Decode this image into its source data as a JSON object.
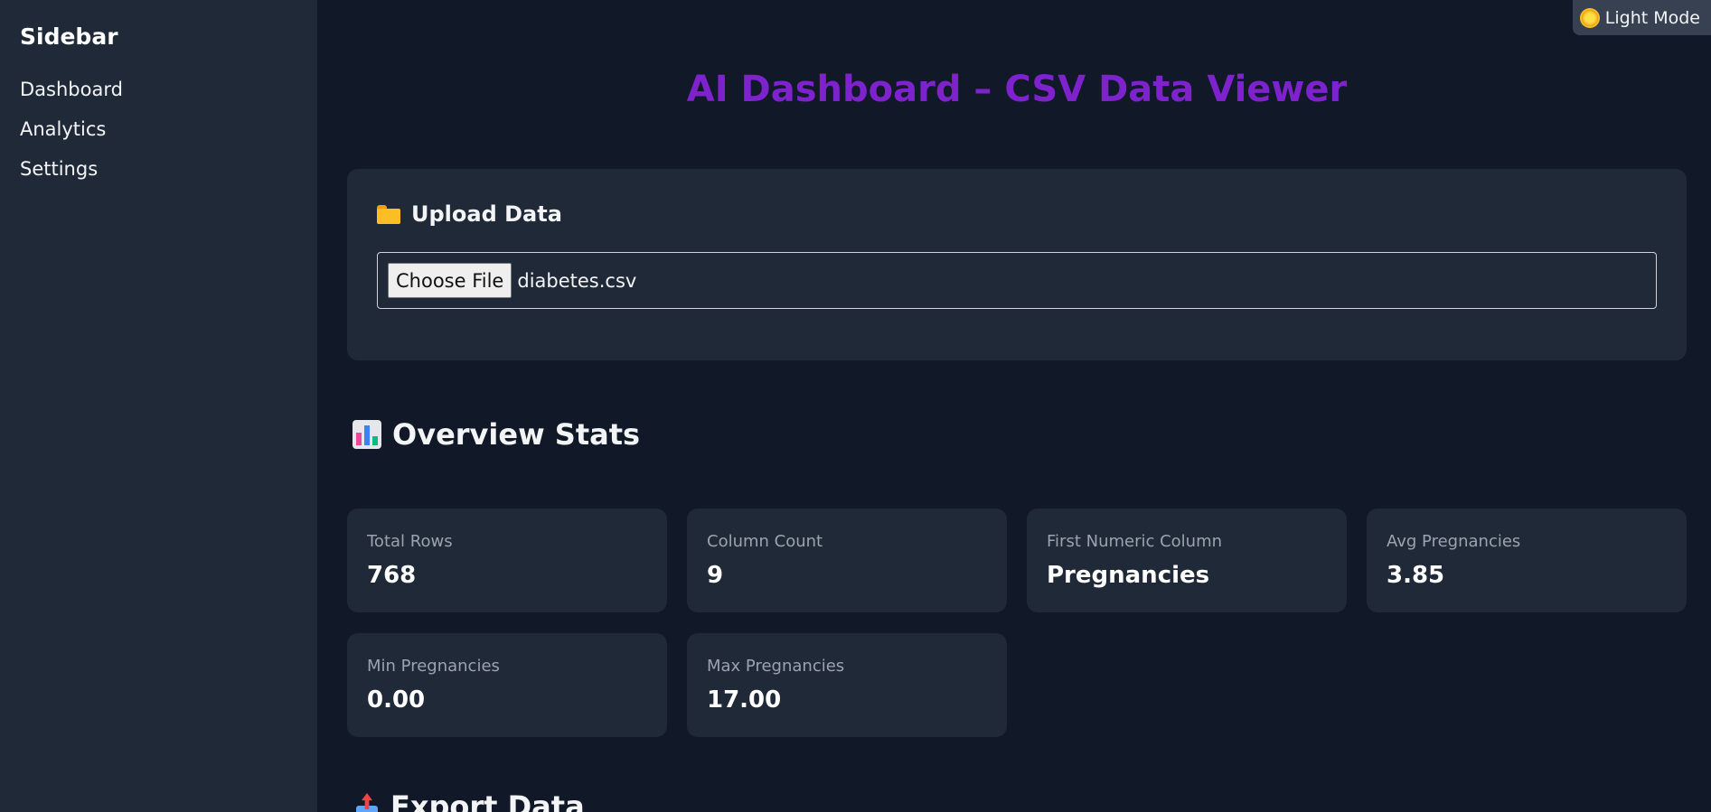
{
  "sidebar": {
    "title": "Sidebar",
    "items": [
      {
        "label": "Dashboard"
      },
      {
        "label": "Analytics"
      },
      {
        "label": "Settings"
      }
    ]
  },
  "header": {
    "theme_toggle_label": "Light Mode",
    "theme_icon": "sun-icon",
    "title": "AI Dashboard – CSV Data Viewer"
  },
  "upload": {
    "heading": "Upload Data",
    "icon": "folder-icon",
    "choose_file_label": "Choose File",
    "file_name": "diabetes.csv"
  },
  "overview": {
    "heading": "Overview Stats",
    "icon": "bar-chart-icon",
    "stats": [
      {
        "label": "Total Rows",
        "value": "768"
      },
      {
        "label": "Column Count",
        "value": "9"
      },
      {
        "label": "First Numeric Column",
        "value": "Pregnancies"
      },
      {
        "label": "Avg Pregnancies",
        "value": "3.85"
      },
      {
        "label": "Min Pregnancies",
        "value": "0.00"
      },
      {
        "label": "Max Pregnancies",
        "value": "17.00"
      }
    ]
  },
  "export": {
    "heading": "Export Data",
    "icon": "outbox-tray-icon"
  },
  "colors": {
    "background": "#111827",
    "panel": "#1f2937",
    "title_accent": "#7e22ce"
  }
}
